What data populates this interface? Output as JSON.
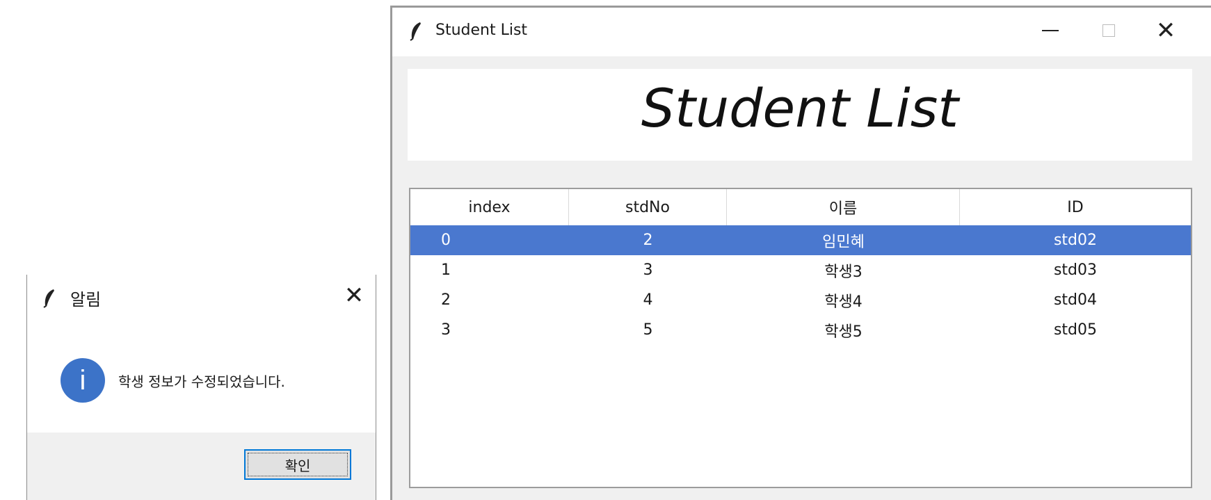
{
  "dialog": {
    "title": "알림",
    "close_label": "✕",
    "message": "학생 정보가 수정되었습니다.",
    "info_icon_glyph": "i",
    "ok_label": "확인",
    "icon": "feather-icon",
    "info_color": "#3c73c8"
  },
  "window": {
    "title": "Student List",
    "icon": "feather-icon",
    "close_label": "✕",
    "heading": "Student List"
  },
  "table": {
    "columns": [
      "index",
      "stdNo",
      "이름",
      "ID"
    ],
    "selected_row": 0,
    "selection_color": "#4a78cf",
    "rows": [
      [
        "0",
        "2",
        "임민혜",
        "std02"
      ],
      [
        "1",
        "3",
        "학생3",
        "std03"
      ],
      [
        "2",
        "4",
        "학생4",
        "std04"
      ],
      [
        "3",
        "5",
        "학생5",
        "std05"
      ]
    ]
  }
}
